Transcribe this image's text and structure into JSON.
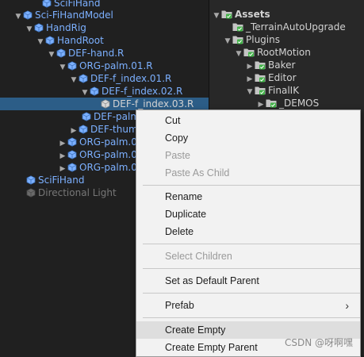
{
  "hierarchy": {
    "items": [
      {
        "label": "SciFiHand",
        "style": "prefab",
        "arrow": ""
      },
      {
        "label": "Sci-FiHandModel",
        "style": "prefab",
        "arrow": "down"
      },
      {
        "label": "HandRig",
        "style": "prefab",
        "arrow": "down"
      },
      {
        "label": "HandRoot",
        "style": "prefab",
        "arrow": "down"
      },
      {
        "label": "DEF-hand.R",
        "style": "prefab",
        "arrow": "down"
      },
      {
        "label": "ORG-palm.01.R",
        "style": "prefab",
        "arrow": "down"
      },
      {
        "label": "DEF-f_index.01.R",
        "style": "prefab",
        "arrow": "down"
      },
      {
        "label": "DEF-f_index.02.R",
        "style": "prefab",
        "arrow": "down"
      },
      {
        "label": "DEF-f_index.03.R",
        "style": "selected",
        "arrow": ""
      },
      {
        "label": "DEF-palm",
        "style": "prefab",
        "arrow": ""
      },
      {
        "label": "DEF-thum",
        "style": "prefab",
        "arrow": "right"
      },
      {
        "label": "ORG-palm.0",
        "style": "prefab",
        "arrow": "right"
      },
      {
        "label": "ORG-palm.0",
        "style": "prefab",
        "arrow": "right"
      },
      {
        "label": "ORG-palm.0",
        "style": "prefab",
        "arrow": "right"
      },
      {
        "label": "SciFiHand",
        "style": "prefab",
        "arrow": ""
      },
      {
        "label": "Directional Light",
        "style": "dim",
        "arrow": ""
      }
    ]
  },
  "project": {
    "items": [
      {
        "label": "Assets",
        "arrow": "down",
        "bold": true
      },
      {
        "label": "_TerrainAutoUpgrade",
        "arrow": ""
      },
      {
        "label": "Plugins",
        "arrow": "down"
      },
      {
        "label": "RootMotion",
        "arrow": "down"
      },
      {
        "label": "Baker",
        "arrow": "right"
      },
      {
        "label": "Editor",
        "arrow": "right"
      },
      {
        "label": "FinalIK",
        "arrow": "down"
      },
      {
        "label": "_DEMOS",
        "arrow": "right"
      }
    ]
  },
  "context_menu": {
    "items": [
      {
        "label": "Cut",
        "enabled": true
      },
      {
        "label": "Copy",
        "enabled": true
      },
      {
        "label": "Paste",
        "enabled": false
      },
      {
        "label": "Paste As Child",
        "enabled": false
      },
      {
        "label": "Rename",
        "enabled": true
      },
      {
        "label": "Duplicate",
        "enabled": true
      },
      {
        "label": "Delete",
        "enabled": true
      },
      {
        "label": "Select Children",
        "enabled": false
      },
      {
        "label": "Set as Default Parent",
        "enabled": true
      },
      {
        "label": "Prefab",
        "enabled": true,
        "submenu": true
      },
      {
        "label": "Create Empty",
        "enabled": true,
        "highlighted": true
      },
      {
        "label": "Create Empty Parent",
        "enabled": true
      }
    ],
    "submenu_arrow": "›"
  },
  "watermark": "CSDN @呀啊嘿",
  "colors": {
    "prefab_text": "#7cb0ff",
    "selection": "#2c5d87",
    "folder": "#c4c4c4",
    "badge": "#44b34a"
  }
}
